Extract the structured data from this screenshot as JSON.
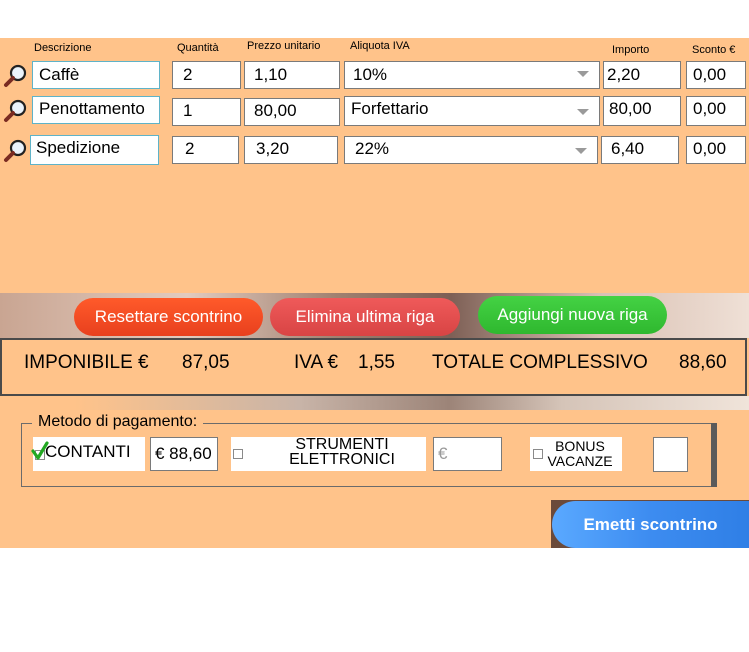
{
  "headers": {
    "descrizione": "Descrizione",
    "quantita": "Quantità",
    "prezzo": "Prezzo unitario",
    "aliquota": "Aliquota IVA",
    "importo": "Importo",
    "sconto": "Sconto €"
  },
  "rows": [
    {
      "descrizione": "Caffè",
      "quantita": "2",
      "prezzo": "1,10",
      "aliquota": "10%",
      "importo": "2,20",
      "sconto": "0,00"
    },
    {
      "descrizione": "Penottamento",
      "quantita": "1",
      "prezzo": "80,00",
      "aliquota": "Forfettario",
      "importo": "80,00",
      "sconto": "0,00"
    },
    {
      "descrizione": "Spedizione",
      "quantita": "2",
      "prezzo": "3,20",
      "aliquota": "22%",
      "importo": "6,40",
      "sconto": "0,00"
    }
  ],
  "actions": {
    "reset": "Resettare scontrino",
    "delete_last": "Elimina ultima riga",
    "add_row": "Aggiungi nuova riga"
  },
  "totals": {
    "imponibile_label": "IMPONIBILE  €",
    "imponibile_value": "87,05",
    "iva_label": "IVA €",
    "iva_value": "1,55",
    "totale_label": "TOTALE COMPLESSIVO",
    "totale_value": "88,60"
  },
  "payment": {
    "legend": "Metodo di pagamento:",
    "contanti_label": "CONTANTI",
    "contanti_value": "€ 88,60",
    "strumenti_line1": "STRUMENTI",
    "strumenti_line2": "ELETTRONICI",
    "strumenti_placeholder": "€",
    "bonus_line1": "BONUS",
    "bonus_line2": "VACANZE",
    "bonus_value": ""
  },
  "emit_button": "Emetti scontrino",
  "colors": {
    "panel": "#FFC38A",
    "reset": "#F04A2A",
    "delete": "#E04848",
    "add": "#3CC43C",
    "emit": "#3D8CF0"
  }
}
